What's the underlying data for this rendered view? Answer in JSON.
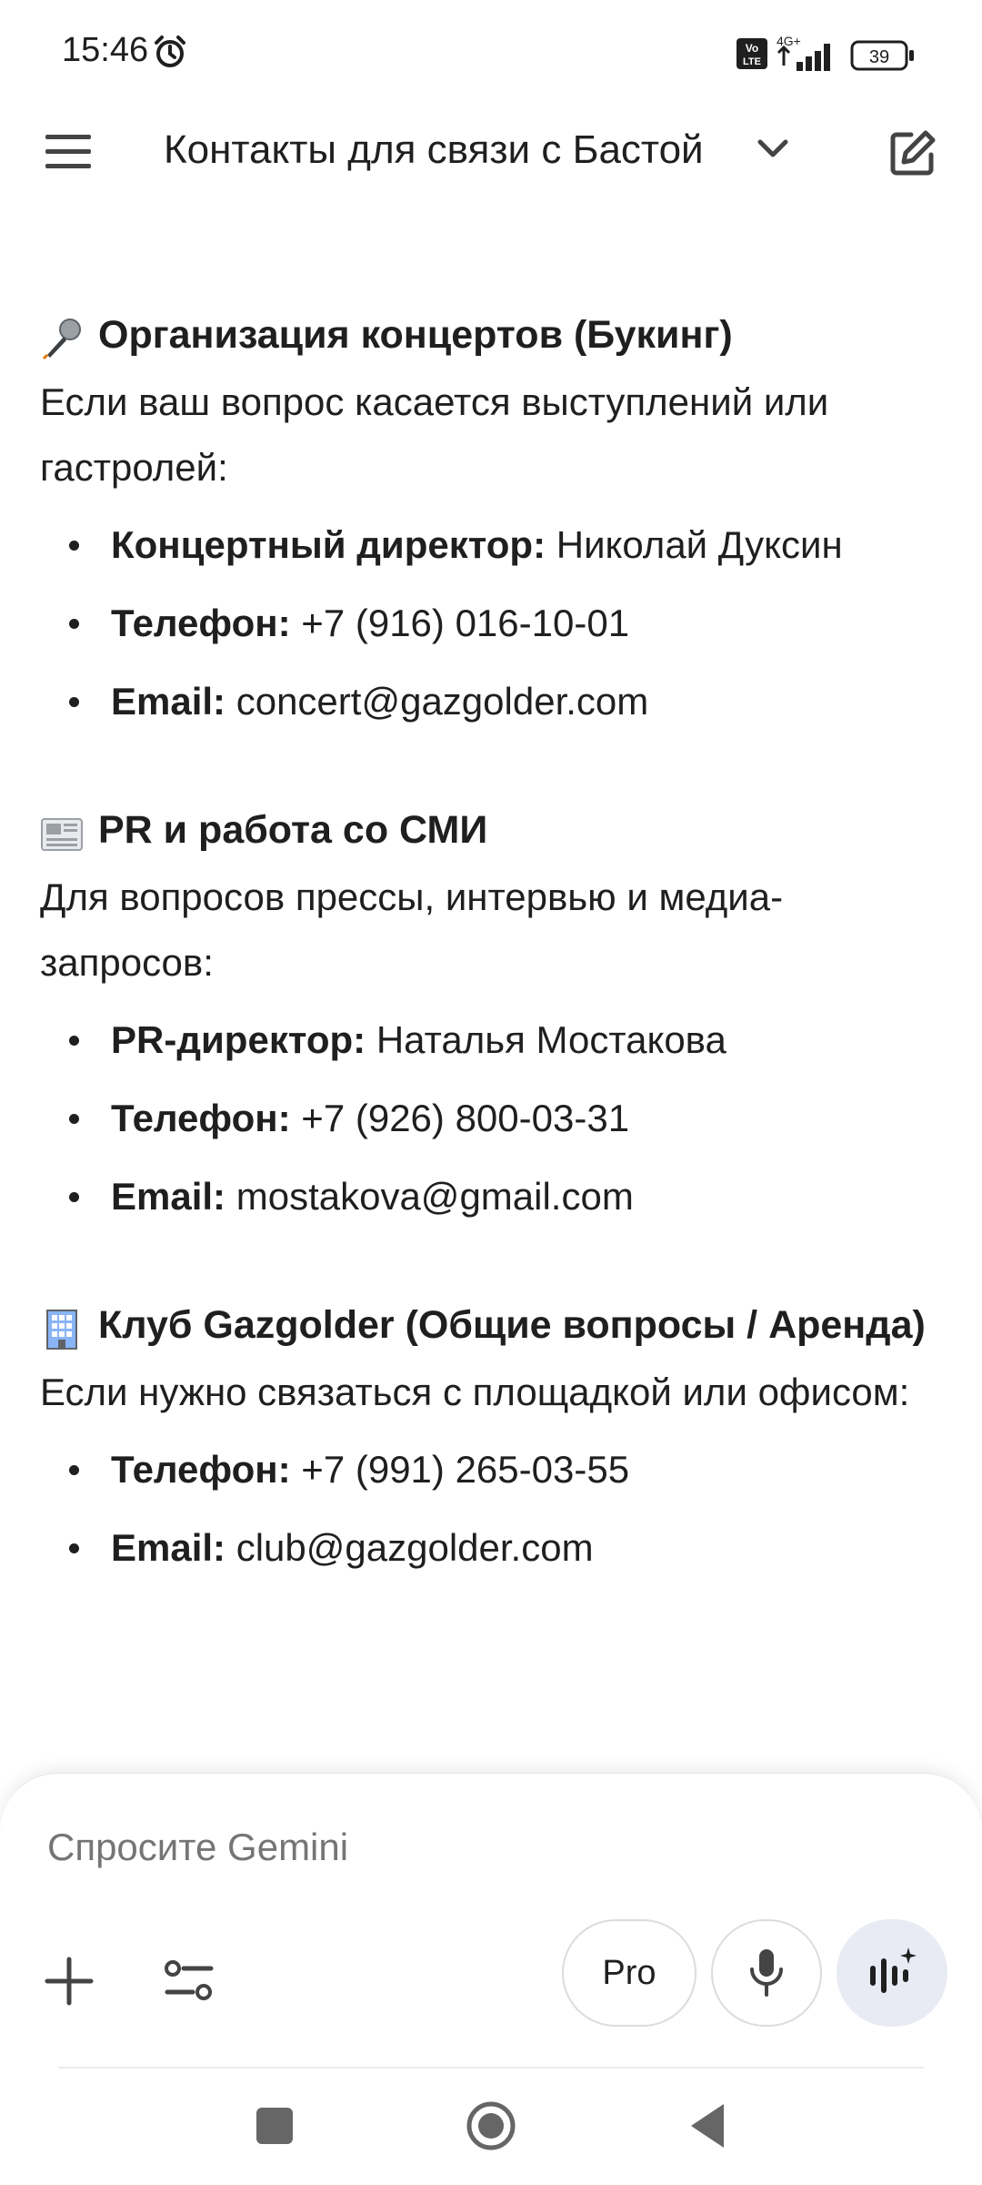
{
  "status_bar": {
    "time": "15:46",
    "volte": "Vo LTE",
    "network": "4G+",
    "battery": "39"
  },
  "app_bar": {
    "title": "Контакты для связи с Бастой",
    "menu_icon": "menu-icon",
    "chevron_icon": "chevron-down-icon",
    "edit_icon": "edit-icon"
  },
  "sections": [
    {
      "emoji": "microphone",
      "title": "Организация концертов (Букинг)",
      "description": "Если ваш вопрос касается выступлений или гастролей:",
      "items": [
        {
          "label": "Концертный директор:",
          "value": "Николай Дуксин"
        },
        {
          "label": "Телефон:",
          "value": "+7 (916) 016-10-01"
        },
        {
          "label": "Email:",
          "value": "concert@gazgolder.com"
        }
      ]
    },
    {
      "emoji": "newspaper",
      "title": "PR и работа со СМИ",
      "description": "Для вопросов прессы, интервью и медиа-запросов:",
      "items": [
        {
          "label": "PR-директор:",
          "value": "Наталья Мостакова"
        },
        {
          "label": "Телефон:",
          "value": "+7 (926) 800-03-31"
        },
        {
          "label": "Email:",
          "value": "mostakova@gmail.com"
        }
      ]
    },
    {
      "emoji": "office-building",
      "title": "Клуб Gazgolder (Общие вопросы / Аренда)",
      "description": "Если нужно связаться с площадкой или офисом:",
      "items": [
        {
          "label": "Телефон:",
          "value": "+7 (991) 265-03-55"
        },
        {
          "label": "Email:",
          "value": "club@gazgolder.com"
        }
      ]
    }
  ],
  "input": {
    "placeholder": "Спросите Gemini",
    "pro_label": "Pro"
  },
  "colors": {
    "text": "#1f1f1f",
    "placeholder": "#757575",
    "live_button_bg": "#e8ebf3",
    "border": "#dadce0"
  }
}
